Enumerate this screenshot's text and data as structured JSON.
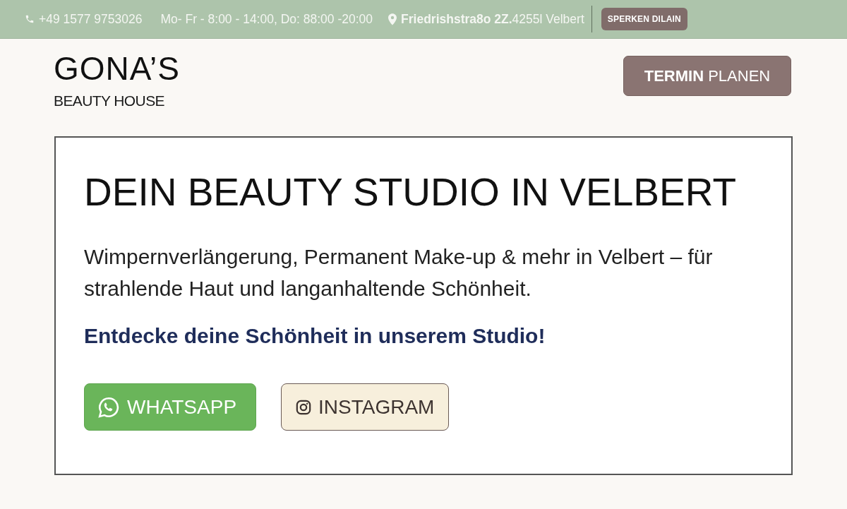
{
  "top_bar": {
    "phone": "+49 1577 9753026",
    "hours": "Mo- Fr - 8:00 - 14:00, Do: 88:00 -20:00",
    "address": "**Friedrishstra8o 2Z.**4255l Velbert",
    "button": "SPERKEN DILAIN"
  },
  "header": {
    "logo_title": "GONA’S",
    "logo_subtitle": "BEAUTY HOUSE",
    "cta_button": "**TERMIN** PLANEN"
  },
  "hero": {
    "title": "DEIN BEAUTY STUDIO IN VELBERT",
    "description": "Wimpernverlängerung, Permanent Make-up & mehr in Velbert – für strahlende Haut und langanhaltende Schönheit.",
    "tagline": "Entdecke deine Schönheit in unserem Studio!",
    "buttons": [
      {
        "kind": "whatsapp",
        "label": "WHATSAPP"
      },
      {
        "kind": "instagram",
        "label": "INSTAGRAM"
      }
    ]
  }
}
